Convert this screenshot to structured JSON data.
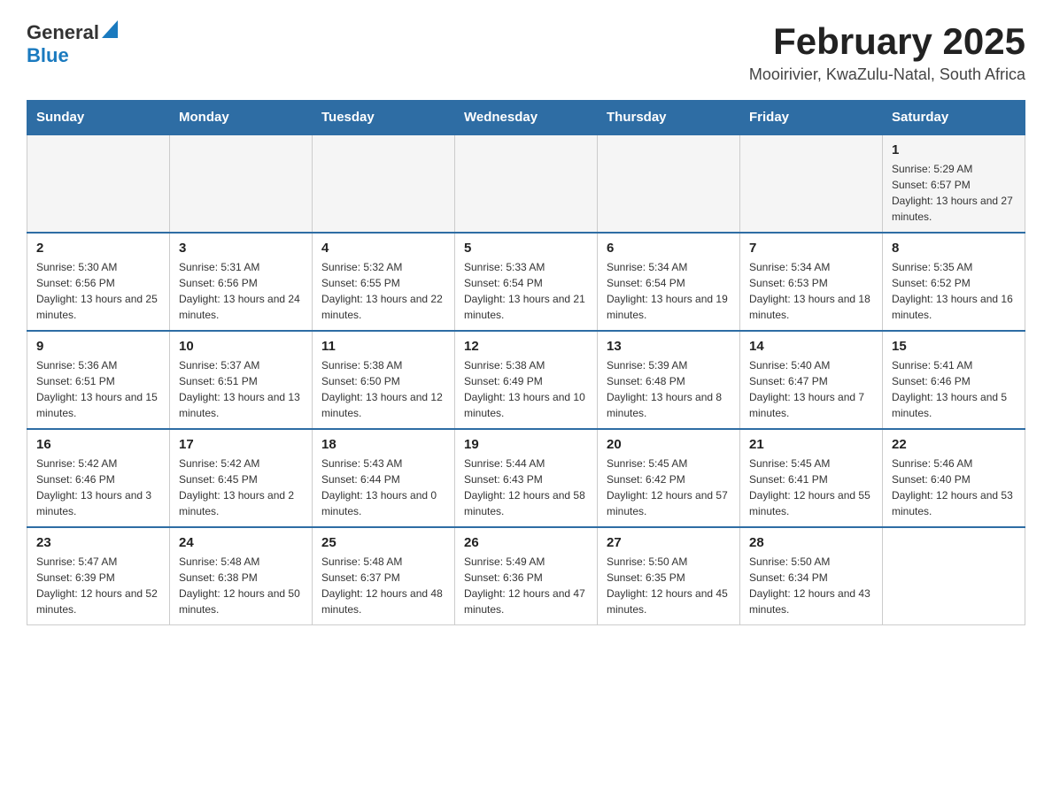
{
  "header": {
    "logo": {
      "general": "General",
      "blue": "Blue"
    },
    "title": "February 2025",
    "subtitle": "Mooirivier, KwaZulu-Natal, South Africa"
  },
  "weekdays": [
    "Sunday",
    "Monday",
    "Tuesday",
    "Wednesday",
    "Thursday",
    "Friday",
    "Saturday"
  ],
  "weeks": [
    [
      {
        "day": "",
        "sunrise": "",
        "sunset": "",
        "daylight": ""
      },
      {
        "day": "",
        "sunrise": "",
        "sunset": "",
        "daylight": ""
      },
      {
        "day": "",
        "sunrise": "",
        "sunset": "",
        "daylight": ""
      },
      {
        "day": "",
        "sunrise": "",
        "sunset": "",
        "daylight": ""
      },
      {
        "day": "",
        "sunrise": "",
        "sunset": "",
        "daylight": ""
      },
      {
        "day": "",
        "sunrise": "",
        "sunset": "",
        "daylight": ""
      },
      {
        "day": "1",
        "sunrise": "Sunrise: 5:29 AM",
        "sunset": "Sunset: 6:57 PM",
        "daylight": "Daylight: 13 hours and 27 minutes."
      }
    ],
    [
      {
        "day": "2",
        "sunrise": "Sunrise: 5:30 AM",
        "sunset": "Sunset: 6:56 PM",
        "daylight": "Daylight: 13 hours and 25 minutes."
      },
      {
        "day": "3",
        "sunrise": "Sunrise: 5:31 AM",
        "sunset": "Sunset: 6:56 PM",
        "daylight": "Daylight: 13 hours and 24 minutes."
      },
      {
        "day": "4",
        "sunrise": "Sunrise: 5:32 AM",
        "sunset": "Sunset: 6:55 PM",
        "daylight": "Daylight: 13 hours and 22 minutes."
      },
      {
        "day": "5",
        "sunrise": "Sunrise: 5:33 AM",
        "sunset": "Sunset: 6:54 PM",
        "daylight": "Daylight: 13 hours and 21 minutes."
      },
      {
        "day": "6",
        "sunrise": "Sunrise: 5:34 AM",
        "sunset": "Sunset: 6:54 PM",
        "daylight": "Daylight: 13 hours and 19 minutes."
      },
      {
        "day": "7",
        "sunrise": "Sunrise: 5:34 AM",
        "sunset": "Sunset: 6:53 PM",
        "daylight": "Daylight: 13 hours and 18 minutes."
      },
      {
        "day": "8",
        "sunrise": "Sunrise: 5:35 AM",
        "sunset": "Sunset: 6:52 PM",
        "daylight": "Daylight: 13 hours and 16 minutes."
      }
    ],
    [
      {
        "day": "9",
        "sunrise": "Sunrise: 5:36 AM",
        "sunset": "Sunset: 6:51 PM",
        "daylight": "Daylight: 13 hours and 15 minutes."
      },
      {
        "day": "10",
        "sunrise": "Sunrise: 5:37 AM",
        "sunset": "Sunset: 6:51 PM",
        "daylight": "Daylight: 13 hours and 13 minutes."
      },
      {
        "day": "11",
        "sunrise": "Sunrise: 5:38 AM",
        "sunset": "Sunset: 6:50 PM",
        "daylight": "Daylight: 13 hours and 12 minutes."
      },
      {
        "day": "12",
        "sunrise": "Sunrise: 5:38 AM",
        "sunset": "Sunset: 6:49 PM",
        "daylight": "Daylight: 13 hours and 10 minutes."
      },
      {
        "day": "13",
        "sunrise": "Sunrise: 5:39 AM",
        "sunset": "Sunset: 6:48 PM",
        "daylight": "Daylight: 13 hours and 8 minutes."
      },
      {
        "day": "14",
        "sunrise": "Sunrise: 5:40 AM",
        "sunset": "Sunset: 6:47 PM",
        "daylight": "Daylight: 13 hours and 7 minutes."
      },
      {
        "day": "15",
        "sunrise": "Sunrise: 5:41 AM",
        "sunset": "Sunset: 6:46 PM",
        "daylight": "Daylight: 13 hours and 5 minutes."
      }
    ],
    [
      {
        "day": "16",
        "sunrise": "Sunrise: 5:42 AM",
        "sunset": "Sunset: 6:46 PM",
        "daylight": "Daylight: 13 hours and 3 minutes."
      },
      {
        "day": "17",
        "sunrise": "Sunrise: 5:42 AM",
        "sunset": "Sunset: 6:45 PM",
        "daylight": "Daylight: 13 hours and 2 minutes."
      },
      {
        "day": "18",
        "sunrise": "Sunrise: 5:43 AM",
        "sunset": "Sunset: 6:44 PM",
        "daylight": "Daylight: 13 hours and 0 minutes."
      },
      {
        "day": "19",
        "sunrise": "Sunrise: 5:44 AM",
        "sunset": "Sunset: 6:43 PM",
        "daylight": "Daylight: 12 hours and 58 minutes."
      },
      {
        "day": "20",
        "sunrise": "Sunrise: 5:45 AM",
        "sunset": "Sunset: 6:42 PM",
        "daylight": "Daylight: 12 hours and 57 minutes."
      },
      {
        "day": "21",
        "sunrise": "Sunrise: 5:45 AM",
        "sunset": "Sunset: 6:41 PM",
        "daylight": "Daylight: 12 hours and 55 minutes."
      },
      {
        "day": "22",
        "sunrise": "Sunrise: 5:46 AM",
        "sunset": "Sunset: 6:40 PM",
        "daylight": "Daylight: 12 hours and 53 minutes."
      }
    ],
    [
      {
        "day": "23",
        "sunrise": "Sunrise: 5:47 AM",
        "sunset": "Sunset: 6:39 PM",
        "daylight": "Daylight: 12 hours and 52 minutes."
      },
      {
        "day": "24",
        "sunrise": "Sunrise: 5:48 AM",
        "sunset": "Sunset: 6:38 PM",
        "daylight": "Daylight: 12 hours and 50 minutes."
      },
      {
        "day": "25",
        "sunrise": "Sunrise: 5:48 AM",
        "sunset": "Sunset: 6:37 PM",
        "daylight": "Daylight: 12 hours and 48 minutes."
      },
      {
        "day": "26",
        "sunrise": "Sunrise: 5:49 AM",
        "sunset": "Sunset: 6:36 PM",
        "daylight": "Daylight: 12 hours and 47 minutes."
      },
      {
        "day": "27",
        "sunrise": "Sunrise: 5:50 AM",
        "sunset": "Sunset: 6:35 PM",
        "daylight": "Daylight: 12 hours and 45 minutes."
      },
      {
        "day": "28",
        "sunrise": "Sunrise: 5:50 AM",
        "sunset": "Sunset: 6:34 PM",
        "daylight": "Daylight: 12 hours and 43 minutes."
      },
      {
        "day": "",
        "sunrise": "",
        "sunset": "",
        "daylight": ""
      }
    ]
  ]
}
